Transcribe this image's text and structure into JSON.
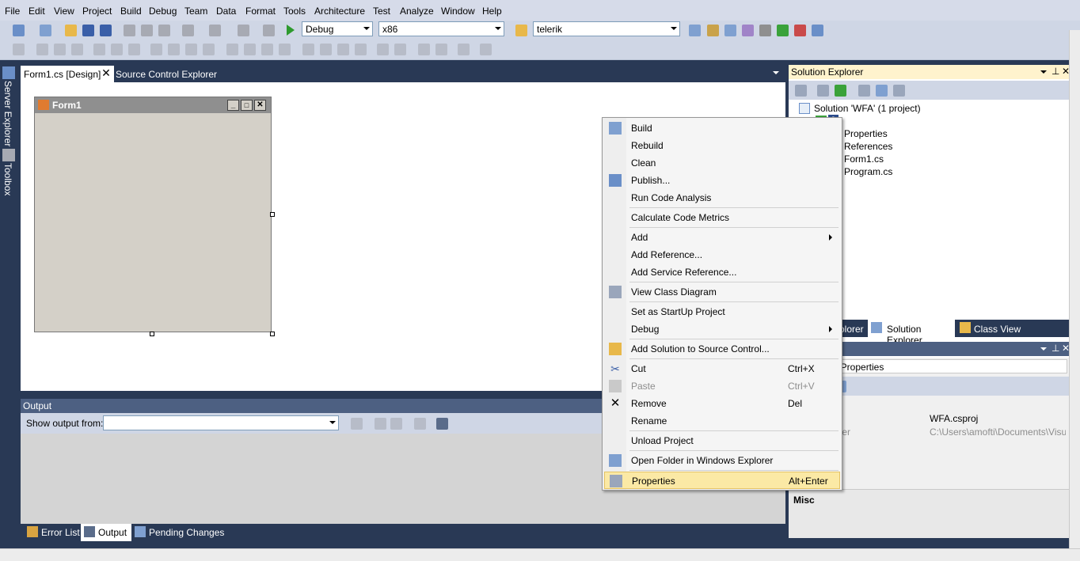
{
  "menu": [
    "File",
    "Edit",
    "View",
    "Project",
    "Build",
    "Debug",
    "Team",
    "Data",
    "Format",
    "Tools",
    "Architecture",
    "Test",
    "Analyze",
    "Window",
    "Help"
  ],
  "toolbar": {
    "config": "Debug",
    "platform": "x86",
    "find": "telerik"
  },
  "doc_tabs": {
    "active": "Form1.cs [Design]",
    "second": "Source Control Explorer"
  },
  "form": {
    "title": "Form1"
  },
  "left_sidebar": {
    "server_explorer": "Server Explorer",
    "toolbox": "Toolbox"
  },
  "output": {
    "title": "Output",
    "show_from_label": "Show output from:",
    "show_from_value": ""
  },
  "bottom_tabs": [
    "Error List",
    "Output",
    "Pending Changes"
  ],
  "solution_explorer": {
    "title": "Solution Explorer",
    "solution": "Solution 'WFA' (1 project)",
    "project": "A",
    "items": [
      "Properties",
      "References",
      "Form1.cs",
      "Program.cs"
    ],
    "tabs": [
      "olorer",
      "Solution Explorer",
      "Class View"
    ]
  },
  "properties": {
    "object": ": Properties",
    "rows": [
      {
        "name": "e",
        "value": "WFA.csproj"
      },
      {
        "name": "lder",
        "value": "C:\\Users\\amofti\\Documents\\Visual S"
      }
    ],
    "misc": "Misc"
  },
  "context_menu": {
    "items": [
      {
        "label": "Build",
        "shortcut": "",
        "icon": "build-icon"
      },
      {
        "label": "Rebuild",
        "shortcut": ""
      },
      {
        "label": "Clean",
        "shortcut": ""
      },
      {
        "label": "Publish...",
        "shortcut": "",
        "icon": "publish-icon"
      },
      {
        "label": "Run Code Analysis",
        "shortcut": ""
      },
      {
        "label": "Calculate Code Metrics",
        "shortcut": ""
      },
      {
        "label": "Add",
        "shortcut": "",
        "submenu": true
      },
      {
        "label": "Add Reference...",
        "shortcut": ""
      },
      {
        "label": "Add Service Reference...",
        "shortcut": ""
      },
      {
        "label": "View Class Diagram",
        "shortcut": "",
        "icon": "class-diagram-icon"
      },
      {
        "label": "Set as StartUp Project",
        "shortcut": ""
      },
      {
        "label": "Debug",
        "shortcut": "",
        "submenu": true
      },
      {
        "label": "Add Solution to Source Control...",
        "shortcut": "",
        "icon": "folder-add-icon"
      },
      {
        "label": "Cut",
        "shortcut": "Ctrl+X",
        "icon": "cut-icon"
      },
      {
        "label": "Paste",
        "shortcut": "Ctrl+V",
        "icon": "paste-icon",
        "disabled": true
      },
      {
        "label": "Remove",
        "shortcut": "Del",
        "icon": "remove-icon"
      },
      {
        "label": "Rename",
        "shortcut": ""
      },
      {
        "label": "Unload Project",
        "shortcut": ""
      },
      {
        "label": "Open Folder in Windows Explorer",
        "shortcut": "",
        "icon": "open-folder-icon"
      },
      {
        "label": "Properties",
        "shortcut": "Alt+Enter",
        "icon": "properties-icon",
        "highlighted": true
      }
    ]
  }
}
